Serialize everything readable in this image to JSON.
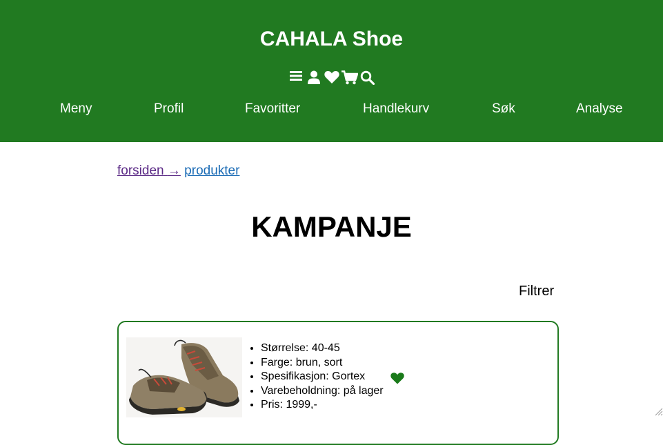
{
  "colors": {
    "brand": "#217a21",
    "heart": "#1a7a1a",
    "visited_link": "#5b2a86",
    "link": "#1a6bb5"
  },
  "header": {
    "title": "CAHALA Shoe",
    "icons": [
      "menu-icon",
      "user-icon",
      "heart-icon",
      "cart-icon",
      "search-icon"
    ],
    "nav": [
      {
        "label": "Meny"
      },
      {
        "label": "Profil"
      },
      {
        "label": "Favoritter"
      },
      {
        "label": "Handlekurv"
      },
      {
        "label": "Søk"
      },
      {
        "label": "Analyse"
      }
    ]
  },
  "breadcrumb": {
    "home": "forsiden",
    "arrow": "→",
    "current": "produkter"
  },
  "main": {
    "title": "KAMPANJE",
    "filter_label": "Filtrer",
    "products": [
      {
        "specs": [
          "Størrelse: 40-45",
          "Farge: brun, sort",
          "Spesifikasjon: Gortex",
          "Varebeholdning: på lager",
          "Pris: 1999,-"
        ],
        "favorite_icon": "heart-icon"
      }
    ]
  }
}
